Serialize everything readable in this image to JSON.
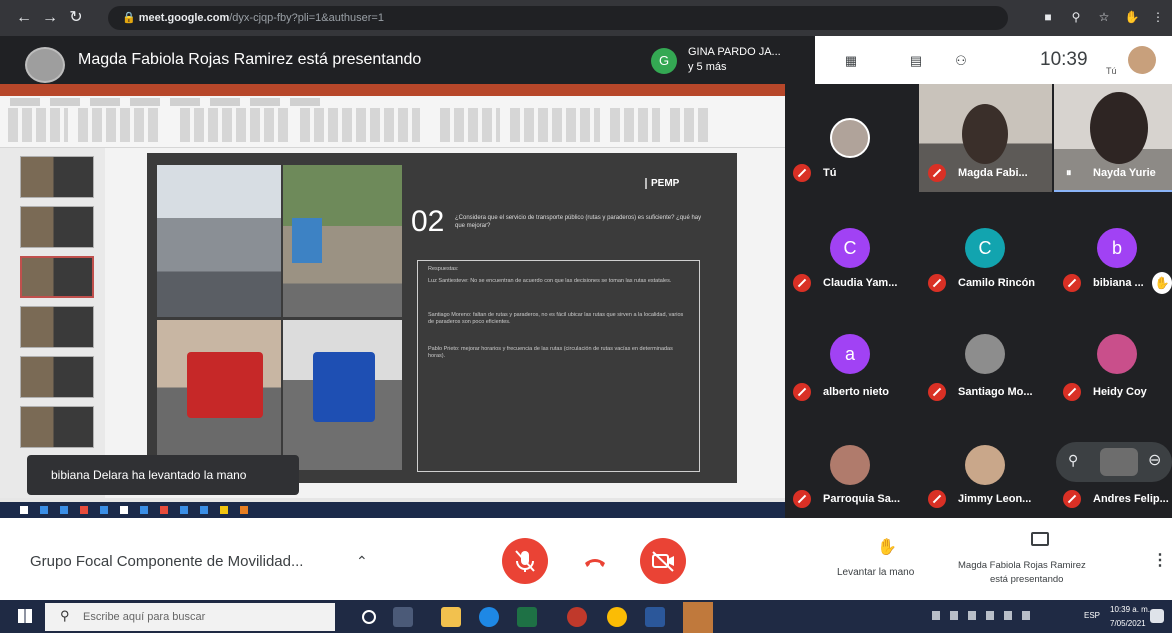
{
  "browser": {
    "url_host": "meet.google.com",
    "url_rest": "/dyx-cjqp-fby?pli=1&authuser=1"
  },
  "meet": {
    "presenter_title": "Magda Fabiola Rojas Ramirez está presentando",
    "participants_chip_letter": "G",
    "participants_chip_name": "GINA PARDO JA...",
    "participants_chip_more": "y 5 más",
    "clock": "10:39",
    "self_label": "Tú"
  },
  "slide": {
    "number": "02",
    "question": "¿Considera que el servicio de transporte público (rutas y paraderos) es suficiente? ¿qué hay que mejorar?",
    "logo": "PEMP",
    "answers_heading": "Respuestas:",
    "answer_1": "Luz Santiesteve: No se encuentran de acuerdo con que las decisiones se toman las rutas estatales.",
    "answer_2": "Santiago Moreno: faltan de rutas y paraderos, no es fácil ubicar las rutas que sirven a la localidad, varios de paraderos son poco eficientes.",
    "answer_3": "Pablo Prieto: mejorar horarios y frecuencia de las rutas (circulación de rutas vacías en determinadas horas)."
  },
  "toast": {
    "text": "bibiana Delara ha levantado la mano"
  },
  "participants": [
    {
      "name": "Tú",
      "initial": "",
      "color": "#b0a39a"
    },
    {
      "name": "Magda Fabi...",
      "initial": "",
      "color": "#6b6f76"
    },
    {
      "name": "Nayda Yurie",
      "initial": "",
      "color": "#6b6f76"
    },
    {
      "name": "Claudia Yam...",
      "initial": "C",
      "color": "#a142f4"
    },
    {
      "name": "Camilo Rincón",
      "initial": "C",
      "color": "#12a4af"
    },
    {
      "name": "bibiana ...",
      "initial": "b",
      "color": "#a142f4"
    },
    {
      "name": "alberto nieto",
      "initial": "a",
      "color": "#a142f4"
    },
    {
      "name": "Santiago Mo...",
      "initial": "",
      "color": "#8d8d8d"
    },
    {
      "name": "Heidy Coy",
      "initial": "",
      "color": "#c94f8b"
    },
    {
      "name": "Parroquia Sa...",
      "initial": "",
      "color": "#b07b6c"
    },
    {
      "name": "Jimmy Leon...",
      "initial": "",
      "color": "#c9a78a"
    },
    {
      "name": "Andres Felip...",
      "initial": "",
      "color": "#555"
    }
  ],
  "controls": {
    "meeting_title": "Grupo Focal Componente de Movilidad...",
    "raise_hand_label": "Levantar la mano",
    "presenting_label_1": "Magda Fabiola Rojas Ramirez",
    "presenting_label_2": "está presentando",
    "mic_color": "#ea4335",
    "end_color": "#ea4335",
    "cam_color": "#ea4335"
  },
  "taskbar": {
    "search_placeholder": "Escribe aquí para buscar",
    "language": "ESP",
    "time": "10:39 a. m.",
    "date": "7/05/2021"
  }
}
